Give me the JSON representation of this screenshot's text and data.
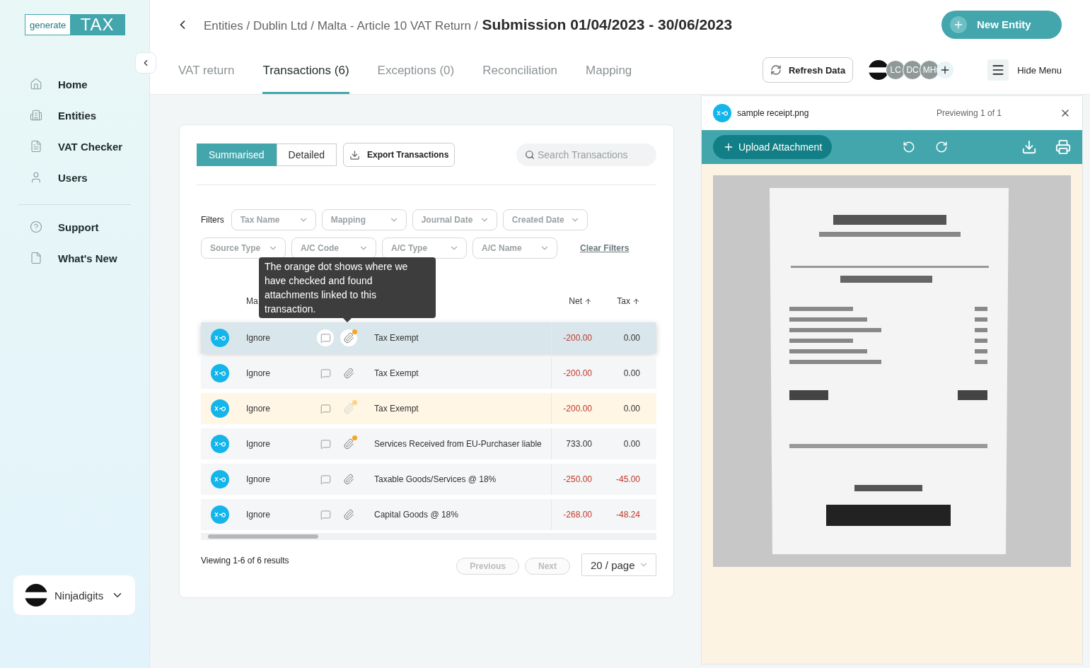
{
  "logo": {
    "left": "generate",
    "right": "TAX"
  },
  "sidebar": {
    "items": [
      {
        "label": "Home"
      },
      {
        "label": "Entities"
      },
      {
        "label": "VAT Checker"
      },
      {
        "label": "Users"
      }
    ],
    "footer_items": [
      {
        "label": "Support"
      },
      {
        "label": "What's New"
      }
    ],
    "account": {
      "name": "Ninjadigits"
    }
  },
  "breadcrumb": {
    "path": "Entities / Dublin Ltd / Malta - Article 10 VAT Return /",
    "current": "Submission 01/04/2023 - 30/06/2023"
  },
  "new_entity_button": "New Entity",
  "tabs": [
    {
      "label": "VAT return",
      "selected": false
    },
    {
      "label": "Transactions (6)",
      "selected": true
    },
    {
      "label": "Exceptions (0)",
      "selected": false
    },
    {
      "label": "Reconciliation",
      "selected": false
    },
    {
      "label": "Mapping",
      "selected": false
    }
  ],
  "refresh_button": "Refresh Data",
  "avatars": [
    {
      "kind": "logo"
    },
    {
      "kind": "initials",
      "initials": "LC"
    },
    {
      "kind": "initials",
      "initials": "DC"
    },
    {
      "kind": "initials",
      "initials": "MH"
    },
    {
      "kind": "add"
    }
  ],
  "hide_menu": "Hide Menu",
  "view_toggle": [
    {
      "label": "Summarised",
      "selected": true
    },
    {
      "label": "Detailed",
      "selected": false
    }
  ],
  "export_button": "Export Transactions",
  "search": {
    "placeholder": "Search Transactions"
  },
  "filters": {
    "label": "Filters",
    "rows": [
      [
        "Tax Name",
        "Mapping",
        "Journal Date",
        "Created Date"
      ],
      [
        "Source Type",
        "A/C Code",
        "A/C Type",
        "A/C Name"
      ]
    ],
    "clear": "Clear Filters"
  },
  "tooltip": "The orange dot shows where we have checked and found attachments linked to this transaction.",
  "table": {
    "columns": {
      "column_1": "Ma",
      "net": "Net",
      "tax": "Tax"
    },
    "rows": [
      {
        "mapping": "Ignore",
        "tax_name": "Tax Exempt",
        "net": "-200.00",
        "tax": "0.00",
        "highlighted": true,
        "selected": false,
        "attachment_found": true
      },
      {
        "mapping": "Ignore",
        "tax_name": "Tax Exempt",
        "net": "-200.00",
        "tax": "0.00",
        "highlighted": false,
        "selected": false,
        "attachment_found": false
      },
      {
        "mapping": "Ignore",
        "tax_name": "Tax Exempt",
        "net": "-200.00",
        "tax": "0.00",
        "highlighted": false,
        "selected": true,
        "attachment_found": true
      },
      {
        "mapping": "Ignore",
        "tax_name": "Services Received from EU-Purchaser liable",
        "net": "733.00",
        "tax": "0.00",
        "highlighted": false,
        "selected": false,
        "attachment_found": true
      },
      {
        "mapping": "Ignore",
        "tax_name": "Taxable Goods/Services @ 18%",
        "net": "-250.00",
        "tax": "-45.00",
        "highlighted": false,
        "selected": false,
        "attachment_found": false
      },
      {
        "mapping": "Ignore",
        "tax_name": "Capital Goods @ 18%",
        "net": "-268.00",
        "tax": "-48.24",
        "highlighted": false,
        "selected": false,
        "attachment_found": false
      }
    ]
  },
  "pagination": {
    "summary": "Viewing 1-6 of 6 results",
    "previous": "Previous",
    "next": "Next",
    "page_size": "20 / page"
  },
  "preview": {
    "file_name": "sample receipt.png",
    "status": "Previewing 1 of 1",
    "upload_button": "Upload Attachment"
  }
}
